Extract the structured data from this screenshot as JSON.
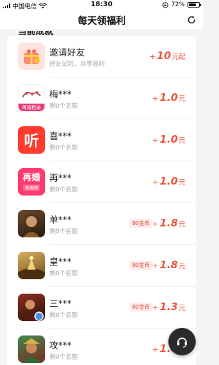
{
  "status_bar": {
    "carrier": "中国电信",
    "time": "18:30",
    "battery_percent": "72%",
    "battery_level": 0.72
  },
  "nav": {
    "title": "每天领福利",
    "refresh_icon": "refresh-icon"
  },
  "section_title": "当前成就",
  "rows": [
    {
      "name": "邀请好友",
      "sub": "好友试玩，共享福利",
      "plus": "+",
      "amount": "10",
      "unit": "元起",
      "badge": "",
      "icon": "invite-gift-icon"
    },
    {
      "name": "梅***",
      "sub": "剩0个名额",
      "plus": "+",
      "amount": "1.0",
      "unit": "元",
      "badge": "",
      "icon": "app-mei-icon",
      "icon_label": "再婚相亲"
    },
    {
      "name": "喜***",
      "sub": "剩0个名额",
      "plus": "+",
      "amount": "1.0",
      "unit": "元",
      "badge": "",
      "icon": "app-xi-icon",
      "icon_label": "听"
    },
    {
      "name": "再***",
      "sub": "剩0个名额",
      "plus": "+",
      "amount": "1.0",
      "unit": "元",
      "badge": "",
      "icon": "app-zai-icon",
      "icon_label": "再婚",
      "icon_sub": "相亲网"
    },
    {
      "name": "单***",
      "sub": "剩0个名额",
      "plus": "+",
      "amount": "1.8",
      "unit": "元",
      "badge": "80金币",
      "icon": "game-dan-icon"
    },
    {
      "name": "皇***",
      "sub": "剩0个名额",
      "plus": "+",
      "amount": "1.8",
      "unit": "元",
      "badge": "80金币",
      "icon": "game-huang-icon"
    },
    {
      "name": "三***",
      "sub": "剩0个名额",
      "plus": "+",
      "amount": "1.3",
      "unit": "元",
      "badge": "80金币",
      "icon": "game-san-icon"
    },
    {
      "name": "攻***",
      "sub": "剩0个名额",
      "plus": "+",
      "amount": "1.0",
      "unit": "元",
      "badge": "",
      "icon": "game-gong-icon"
    }
  ],
  "support_icon": "headset-icon",
  "colors": {
    "accent": "#f0553f",
    "badge_bg": "#fdeaea",
    "support_bg": "#2b2b2b"
  }
}
